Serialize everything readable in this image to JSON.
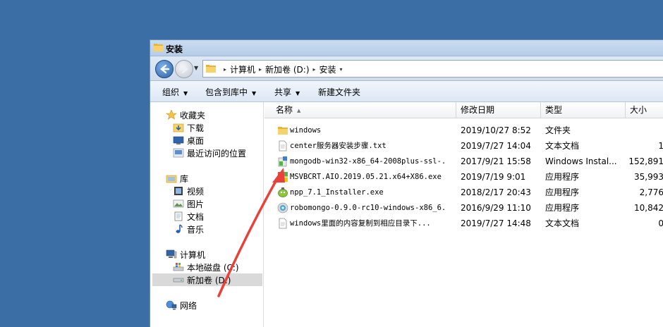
{
  "window": {
    "title": "安装"
  },
  "address": {
    "crumbs": [
      "计算机",
      "新加卷 (D:)",
      "安装"
    ]
  },
  "toolbar": {
    "organize": "组织",
    "include_library": "包含到库中",
    "share": "共享",
    "new_folder": "新建文件夹"
  },
  "nav": {
    "favorites": "收藏夹",
    "downloads": "下载",
    "desktop": "桌面",
    "recent": "最近访问的位置",
    "libraries": "库",
    "videos": "视频",
    "pictures": "图片",
    "documents": "文档",
    "music": "音乐",
    "computer": "计算机",
    "local_disk": "本地磁盘 (C:)",
    "new_volume": "新加卷 (D:)",
    "network": "网络"
  },
  "columns": {
    "name": "名称",
    "date": "修改日期",
    "type": "类型",
    "size": "大小"
  },
  "files": [
    {
      "name": "windows",
      "date": "2019/10/27 8:52",
      "type": "文件夹",
      "size": "",
      "icon": "folder-icon"
    },
    {
      "name": "center服务器安装步骤.txt",
      "date": "2019/7/27 14:04",
      "type": "文本文档",
      "size": "1",
      "icon": "text-file-icon"
    },
    {
      "name": "mongodb-win32-x86_64-2008plus-ssl-...",
      "date": "2017/9/21 15:58",
      "type": "Windows Instal...",
      "size": "152,891",
      "icon": "installer-icon"
    },
    {
      "name": "MSVBCRT.AIO.2019.05.21.x64+X86.exe",
      "date": "2019/7/19 9:01",
      "type": "应用程序",
      "size": "35,993",
      "icon": "windows-app-icon"
    },
    {
      "name": "npp_7.1_Installer.exe",
      "date": "2018/2/17 20:43",
      "type": "应用程序",
      "size": "2,776",
      "icon": "notepadpp-icon"
    },
    {
      "name": "robomongo-0.9.0-rc10-windows-x86_6...",
      "date": "2016/9/29 11:10",
      "type": "应用程序",
      "size": "10,842",
      "icon": "robomongo-icon"
    },
    {
      "name": "windows里面的内容复制到相应目录下...",
      "date": "2019/7/27 14:48",
      "type": "文本文档",
      "size": "0",
      "icon": "text-file-icon"
    }
  ],
  "colors": {
    "desktop": "#3a6ea5",
    "annotation_arrow": "#e8413a"
  }
}
